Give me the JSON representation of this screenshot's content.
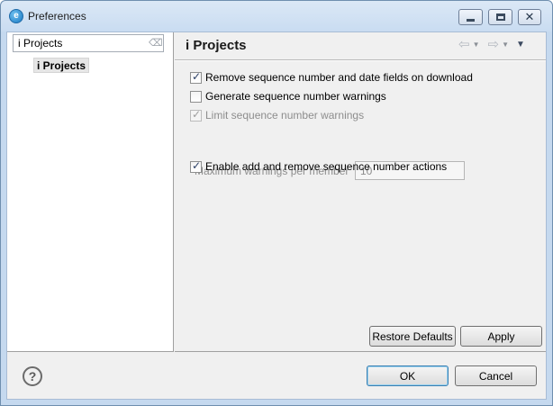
{
  "window": {
    "title": "Preferences"
  },
  "left": {
    "filter_value": "i Projects",
    "tree_items": [
      "i Projects"
    ]
  },
  "page": {
    "title": "i Projects"
  },
  "options": [
    {
      "label": "Remove sequence number and date fields on download",
      "checked": true,
      "enabled": true
    },
    {
      "label": "Generate sequence number warnings",
      "checked": false,
      "enabled": true
    },
    {
      "label": "Limit sequence number warnings",
      "checked": true,
      "enabled": false
    },
    {
      "label": "Enable add and remove sequence number actions",
      "checked": true,
      "enabled": true
    }
  ],
  "max_warnings": {
    "label": "Maximum warnings per member",
    "value": "10"
  },
  "buttons": {
    "restore_defaults": "Restore Defaults",
    "apply": "Apply",
    "ok": "OK",
    "cancel": "Cancel"
  },
  "icons": {
    "help": "?",
    "minimize": "minimize-icon",
    "maximize": "maximize-icon",
    "close": "close-icon"
  }
}
